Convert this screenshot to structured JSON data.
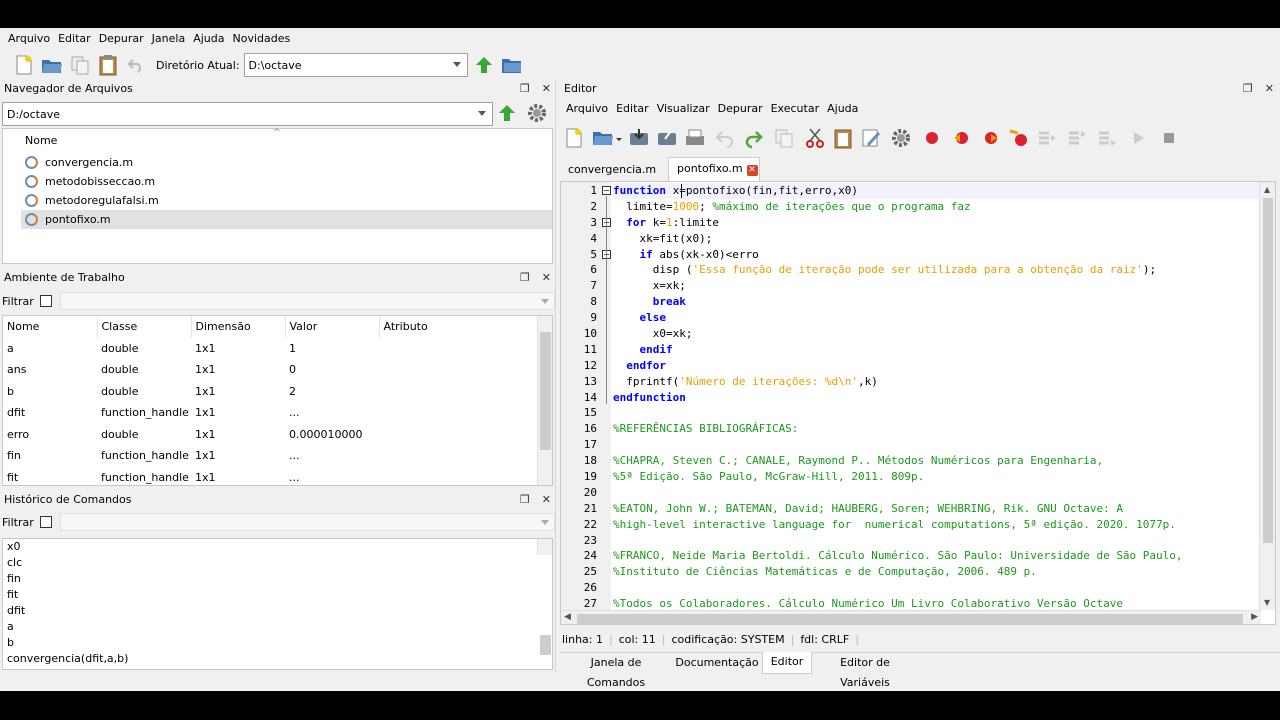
{
  "menubar": {
    "items": [
      "Arquivo",
      "Editar",
      "Depurar",
      "Janela",
      "Ajuda",
      "Novidades"
    ]
  },
  "toolbar": {
    "dir_label": "Diretório Atual:",
    "dir_value": "D:\\octave"
  },
  "file_browser": {
    "title": "Navegador de Arquivos",
    "path": "D:/octave",
    "column_header": "Nome",
    "files": [
      "convergencia.m",
      "metodobisseccao.m",
      "metodoregulafalsi.m",
      "pontofixo.m"
    ]
  },
  "workspace": {
    "title": "Ambiente de Trabalho",
    "filter_label": "Filtrar",
    "columns": [
      "Nome",
      "Classe",
      "Dimensão",
      "Valor",
      "Atributo"
    ],
    "rows": [
      [
        "a",
        "double",
        "1x1",
        "1",
        ""
      ],
      [
        "ans",
        "double",
        "1x1",
        "0",
        ""
      ],
      [
        "b",
        "double",
        "1x1",
        "2",
        ""
      ],
      [
        "dfit",
        "function_handle",
        "1x1",
        "...",
        ""
      ],
      [
        "erro",
        "double",
        "1x1",
        "0.000010000",
        ""
      ],
      [
        "fin",
        "function_handle",
        "1x1",
        "...",
        ""
      ],
      [
        "fit",
        "function_handle",
        "1x1",
        "...",
        ""
      ]
    ]
  },
  "history": {
    "title": "Histórico de Comandos",
    "filter_label": "Filtrar",
    "items": [
      "x0",
      "clc",
      "fin",
      "fit",
      "dfit",
      "a",
      "b",
      "convergencia(dfit,a,b)"
    ]
  },
  "editor": {
    "title": "Editor",
    "menu": [
      "Arquivo",
      "Editar",
      "Visualizar",
      "Depurar",
      "Executar",
      "Ajuda"
    ],
    "tabs": [
      "convergencia.m",
      "pontofixo.m"
    ],
    "status": {
      "line": "linha: 1",
      "col": "col: 11",
      "encoding": "codificação: SYSTEM",
      "eol": "fdl: CRLF"
    },
    "line_numbers": [
      "1",
      "2",
      "3",
      "4",
      "5",
      "6",
      "7",
      "8",
      "9",
      "10",
      "11",
      "12",
      "13",
      "14",
      "15",
      "16",
      "17",
      "18",
      "19",
      "20",
      "21",
      "22",
      "23",
      "24",
      "25",
      "26",
      "27"
    ],
    "code": {
      "l1_kw": "function",
      "l1_rest": " x=pontofixo(fin,fit,erro,x0)",
      "l2_a": "  limite=",
      "l2_num": "1000",
      "l2_b": "; ",
      "l2_cm": "%máximo de iterações que o programa faz",
      "l3_kw": "  for",
      "l3_rest": " k=",
      "l3_num": "1",
      "l3_rest2": ":limite",
      "l4": "    xk=fit(x0);",
      "l5_kw": "    if",
      "l5_rest": " abs(xk-x0)<erro",
      "l6_a": "      disp (",
      "l6_str": "'Essa função de iteração pode ser utilizada para a obtenção da raiz'",
      "l6_b": ");",
      "l7": "      x=xk;",
      "l8_kw": "      break",
      "l9_kw": "    else",
      "l10": "      x0=xk;",
      "l11_kw": "    endif",
      "l12_kw": "  endfor",
      "l13_a": "  fprintf(",
      "l13_str": "'Número de iterações: %d\\n'",
      "l13_b": ",k)",
      "l14_kw": "endfunction",
      "l16": "%REFERÊNCIAS BIBLIOGRÁFICAS:",
      "l18": "%CHAPRA, Steven C.; CANALE, Raymond P.. Métodos Numéricos para Engenharia,",
      "l19": "%5ª Edição. São Paulo, McGraw-Hill, 2011. 809p.",
      "l21": "%EATON, John W.; BATEMAN, David; HAUBERG, Soren; WEHBRING, Rik. GNU Octave: A",
      "l22": "%high-level interactive language for  numerical computations, 5ª edição. 2020. 1077p.",
      "l24": "%FRANCO, Neide Maria Bertoldi. Cálculo Numérico. São Paulo: Universidade de São Paulo,",
      "l25": "%Instituto de Ciências Matemáticas e de Computação, 2006. 489 p.",
      "l27": "%Todos os Colaboradores. Cálculo Numérico Um Livro Colaborativo Versão Octave"
    }
  },
  "bottom_tabs": [
    "Janela de Comandos",
    "Documentação",
    "Editor",
    "Editor de Variáveis"
  ],
  "colors": {
    "keyword": "#0000ff",
    "string": "#e8a000",
    "comment": "#1a9a1a"
  }
}
